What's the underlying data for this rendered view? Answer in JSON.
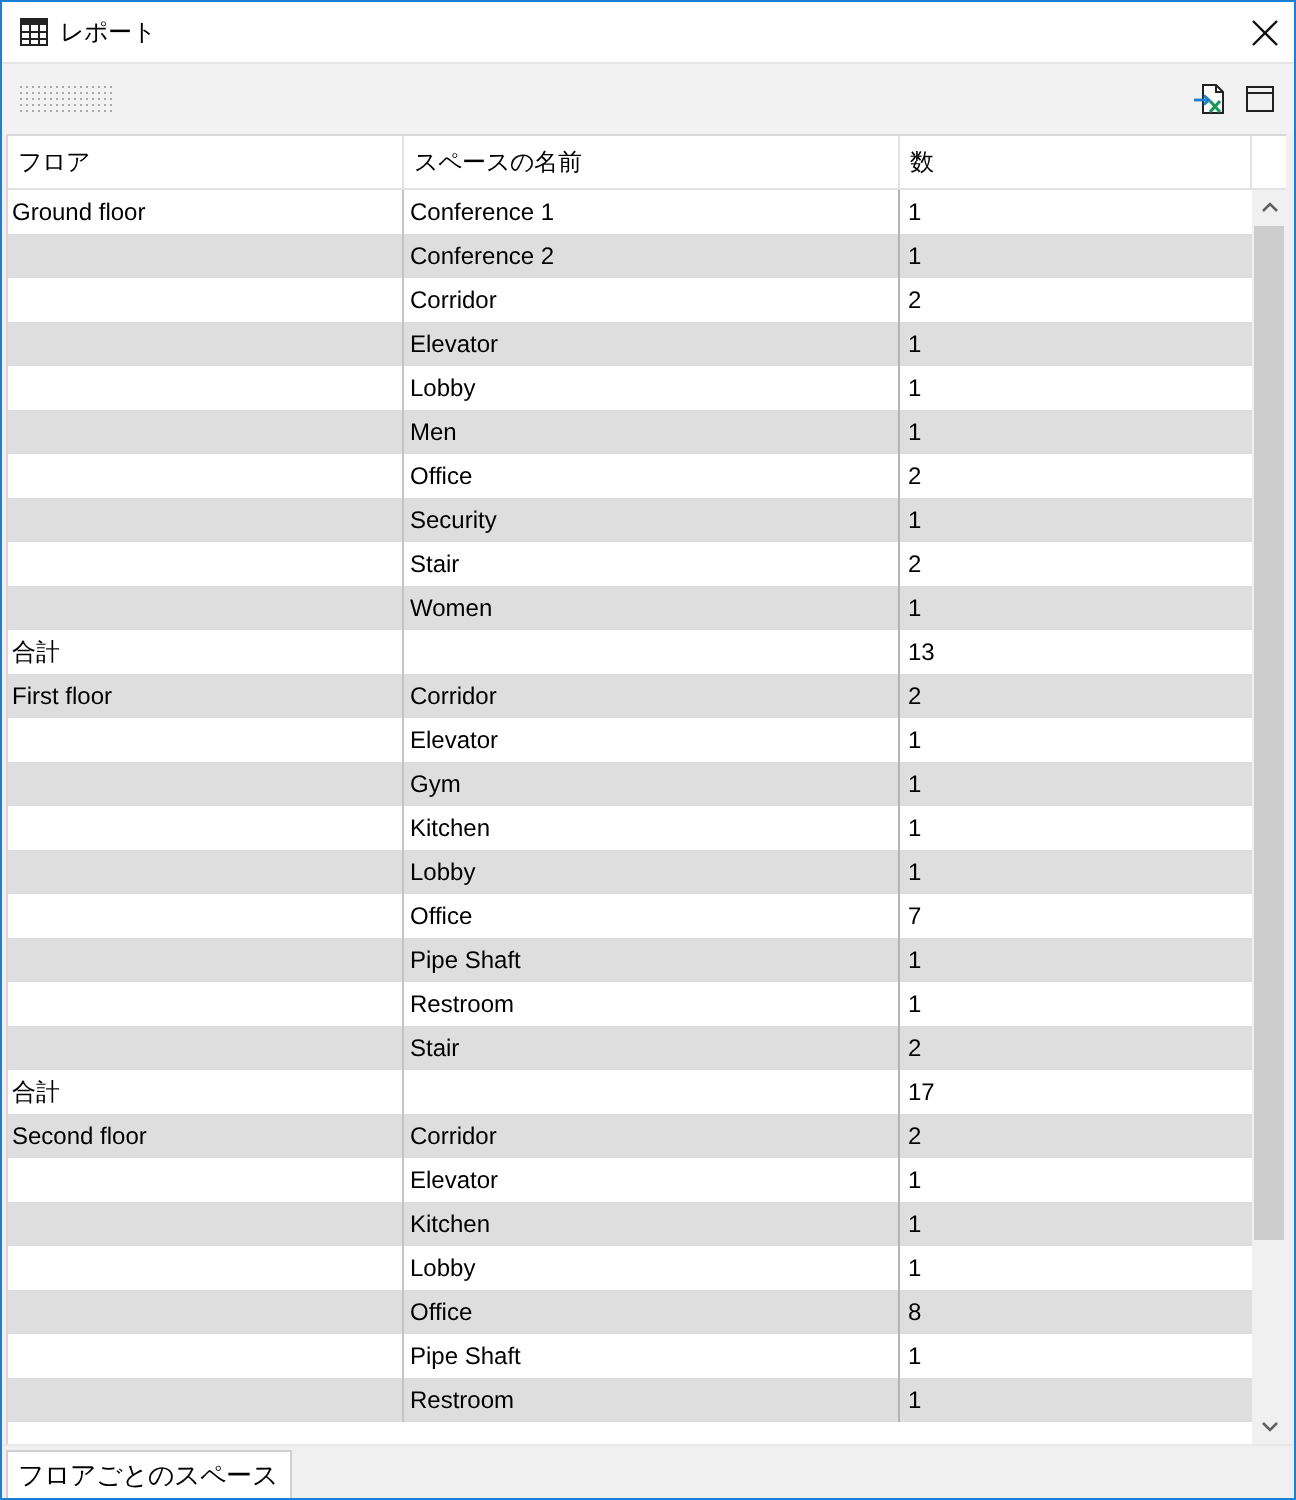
{
  "window": {
    "title": "レポート"
  },
  "table": {
    "columns": [
      {
        "label": "フロア"
      },
      {
        "label": "スペースの名前"
      },
      {
        "label": "数"
      }
    ],
    "rows": [
      {
        "floor": "Ground floor",
        "space_name": "Conference 1",
        "count": "1"
      },
      {
        "space_name": "Conference 2",
        "count": "1"
      },
      {
        "space_name": "Corridor",
        "count": "2"
      },
      {
        "space_name": "Elevator",
        "count": "1"
      },
      {
        "space_name": "Lobby",
        "count": "1"
      },
      {
        "space_name": "Men",
        "count": "1"
      },
      {
        "space_name": "Office",
        "count": "2"
      },
      {
        "space_name": "Security",
        "count": "1"
      },
      {
        "space_name": "Stair",
        "count": "2"
      },
      {
        "space_name": "Women",
        "count": "1"
      },
      {
        "floor": "合計",
        "count": "13"
      },
      {
        "floor": "First floor",
        "space_name": "Corridor",
        "count": "2"
      },
      {
        "space_name": "Elevator",
        "count": "1"
      },
      {
        "space_name": "Gym",
        "count": "1"
      },
      {
        "space_name": "Kitchen",
        "count": "1"
      },
      {
        "space_name": "Lobby",
        "count": "1"
      },
      {
        "space_name": "Office",
        "count": "7"
      },
      {
        "space_name": "Pipe Shaft",
        "count": "1"
      },
      {
        "space_name": "Restroom",
        "count": "1"
      },
      {
        "space_name": "Stair",
        "count": "2"
      },
      {
        "floor": "合計",
        "count": "17"
      },
      {
        "floor": "Second floor",
        "space_name": "Corridor",
        "count": "2"
      },
      {
        "space_name": "Elevator",
        "count": "1"
      },
      {
        "space_name": "Kitchen",
        "count": "1"
      },
      {
        "space_name": "Lobby",
        "count": "1"
      },
      {
        "space_name": "Office",
        "count": "8"
      },
      {
        "space_name": "Pipe Shaft",
        "count": "1"
      },
      {
        "space_name": "Restroom",
        "count": "1"
      }
    ]
  },
  "sheet_tabs": [
    {
      "label": "フロアごとのスペース",
      "selected": true
    }
  ]
}
